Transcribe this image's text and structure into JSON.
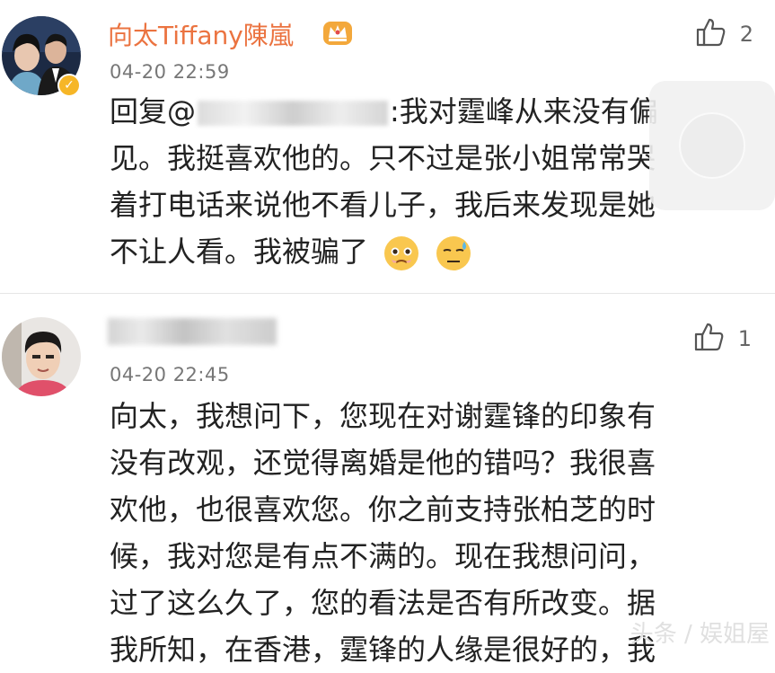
{
  "comments": [
    {
      "username": "向太Tiffany陳嵐",
      "timestamp": "04-20 22:59",
      "like_count": "2",
      "reply_prefix": "回复@",
      "body_after_mention": ":我对霆峰从来没有偏",
      "lines": [
        "见。我挺喜欢他的。只不过是张小姐常常哭",
        "着打电话来说他不看儿子，我后来发现是她",
        "不让人看。我被骗了"
      ],
      "emojis": [
        "pleading-face-emoji",
        "cold-sweat-face-emoji"
      ]
    },
    {
      "timestamp": "04-20 22:45",
      "like_count": "1",
      "lines": [
        "向太，我想问下，您现在对谢霆锋的印象有",
        "没有改观，还觉得离婚是他的错吗？我很喜",
        "欢他，也很喜欢您。你之前支持张柏芝的时",
        "候，我对您是有点不满的。现在我想问问，",
        "过了这么久了，您的看法是否有所改变。据",
        "我所知，在香港，霆锋的人缘是很好的，我"
      ]
    }
  ],
  "watermark": "头条 / 娱姐屋",
  "colors": {
    "username": "#eb7340",
    "timestamp": "#777777",
    "verified_badge": "#f6b627"
  }
}
